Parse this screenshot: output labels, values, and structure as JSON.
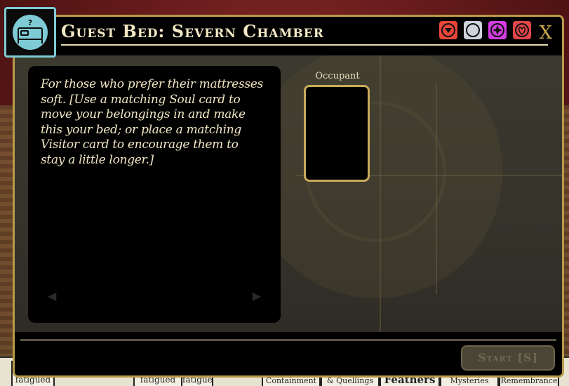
{
  "background": {
    "cards": [
      "fatigued",
      "fatigued",
      "fatigued",
      "Containment",
      "& Quellings",
      "Feathers",
      "Mysteries",
      "Remembrance"
    ]
  },
  "window": {
    "title": "Guest Bed: Severn Chamber",
    "close_label": "X",
    "aspects": [
      {
        "icon": "forge-aspect-icon",
        "color": "#e8453a"
      },
      {
        "icon": "moon-aspect-icon",
        "color": "#cfd3dc"
      },
      {
        "icon": "lantern-aspect-icon",
        "color": "#d33ce0"
      },
      {
        "icon": "heart-aspect-icon",
        "color": "#e2464a"
      }
    ],
    "description": "For those who prefer their mattresses soft.  [Use a matching Soul card to move your belongings in and make this your bed; or place a matching Visitor card to encourage them to stay a little longer.]",
    "slot": {
      "label": "Occupant"
    },
    "start_label": "Start [S]"
  },
  "colors": {
    "accent_gold": "#b89a4a",
    "title_text": "#f1e7c4",
    "verb_icon_border": "#7ecbd6"
  }
}
